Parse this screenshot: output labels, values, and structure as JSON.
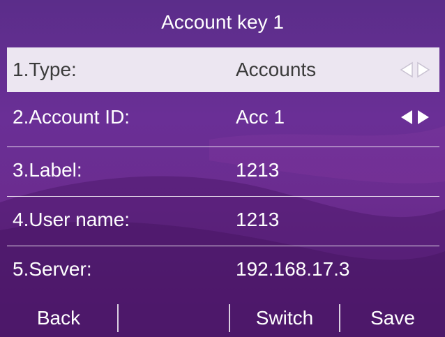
{
  "title": "Account key 1",
  "rows": [
    {
      "label": "1.Type:",
      "value": "Accounts",
      "arrows_icon": "left-right-arrows-icon",
      "selected": true
    },
    {
      "label": "2.Account ID:",
      "value": "Acc 1",
      "arrows_icon": "left-right-arrows-icon",
      "selected": false
    },
    {
      "label": "3.Label:",
      "value": "1213"
    },
    {
      "label": "4.User name:",
      "value": "1213"
    },
    {
      "label": "5.Server:",
      "value": "192.168.17.3"
    }
  ],
  "softkeys": {
    "back": "Back",
    "empty": "",
    "switch": "Switch",
    "save": "Save"
  },
  "colors": {
    "background": "#6a2f96",
    "selected_row": "#ece6f1",
    "text": "#ffffff"
  }
}
